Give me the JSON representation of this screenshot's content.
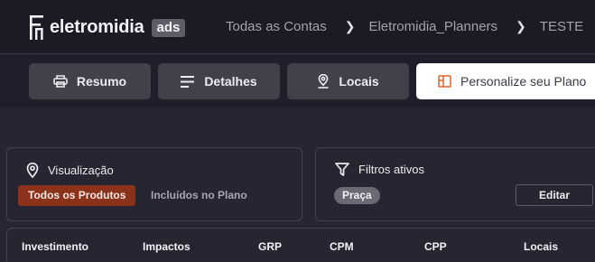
{
  "header": {
    "logo_text": "eletromidia",
    "logo_badge": "ads",
    "breadcrumb": [
      "Todas as Contas",
      "Eletromidia_Planners",
      "TESTE"
    ]
  },
  "tabs": [
    {
      "label": "Resumo",
      "icon": "printer-icon"
    },
    {
      "label": "Detalhes",
      "icon": "lines-icon"
    },
    {
      "label": "Locais",
      "icon": "location-pin-icon"
    },
    {
      "label": "Personalize seu Plano",
      "icon": "layout-icon",
      "active": true
    }
  ],
  "visualizacao": {
    "title": "Visualização",
    "icon": "map-pin-icon",
    "options": [
      "Todos os Produtos",
      "Incluídos no Plano"
    ],
    "selected": "Todos os Produtos"
  },
  "filtros": {
    "title": "Filtros ativos",
    "icon": "filter-icon",
    "chips": [
      "Praça"
    ],
    "edit_label": "Editar"
  },
  "table": {
    "columns": [
      "Investimento",
      "Impactos",
      "GRP",
      "CPM",
      "CPP",
      "Locais"
    ]
  },
  "colors": {
    "accent": "#8a321a",
    "active_tab_icon": "#e0632d",
    "header_bg": "#1b1b26",
    "page_bg": "#262633"
  }
}
